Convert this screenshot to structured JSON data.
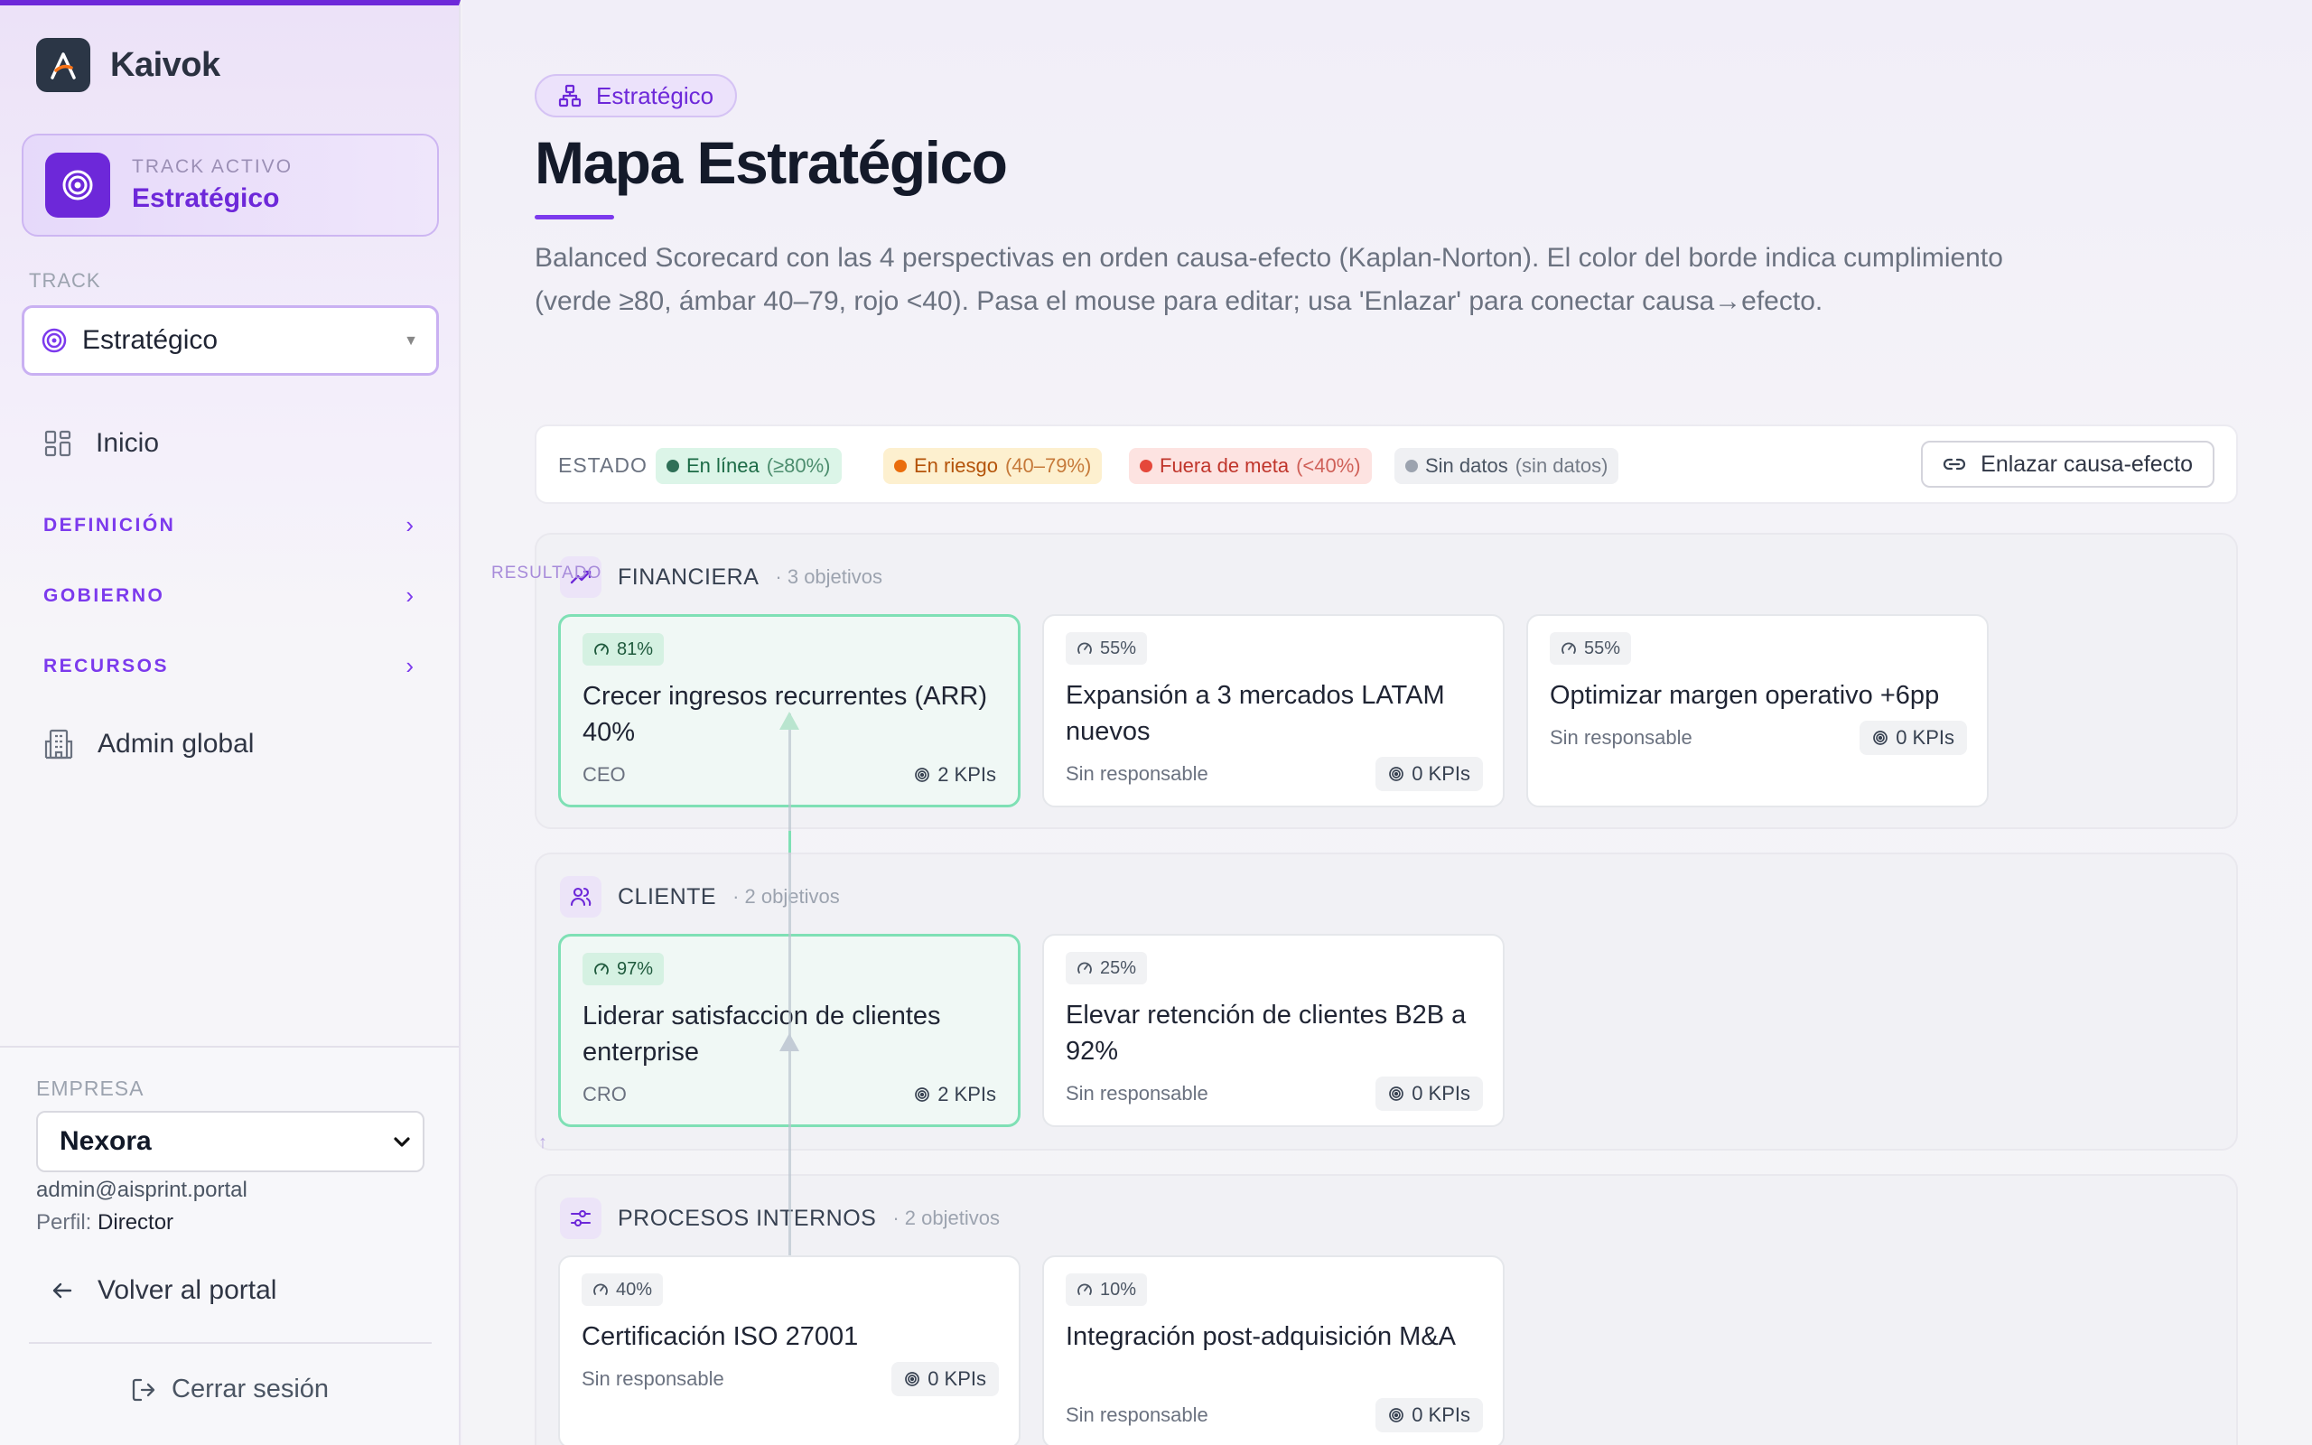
{
  "app": {
    "brand": "Kaivok",
    "colors": {
      "accent": "#6d28d9",
      "ok": "#22a06b",
      "warn": "#f59e0b",
      "bad": "#ef4444",
      "none": "#9ca3af"
    }
  },
  "sidebar": {
    "active_track": {
      "caption": "TRACK ACTIVO",
      "name": "Estratégico",
      "icon": "target-icon"
    },
    "track_label": "TRACK",
    "track_select": {
      "value": "Estratégico",
      "icon": "target-icon"
    },
    "nav": {
      "home": {
        "label": "Inicio",
        "icon": "grid-icon"
      },
      "sections": [
        {
          "label": "DEFINICIÓN"
        },
        {
          "label": "GOBIERNO"
        },
        {
          "label": "RECURSOS"
        }
      ],
      "admin": {
        "label": "Admin global",
        "icon": "building-icon"
      }
    },
    "company": {
      "label": "EMPRESA",
      "value": "Nexora",
      "email": "admin@aisprint.portal",
      "role_label": "Perfil:",
      "role_value": "Director"
    },
    "back_label": "Volver al portal",
    "logout_label": "Cerrar sesión"
  },
  "main": {
    "pill_label": "Estratégico",
    "title": "Mapa Estratégico",
    "description": "Balanced Scorecard con las 4 perspectivas en orden causa-efecto (Kaplan-Norton). El color del borde indica cumplimiento (verde ≥80, ámbar 40–79, rojo <40). Pasa el mouse para editar; usa 'Enlazar' para conectar causa→efecto.",
    "legend": {
      "caption": "ESTADO",
      "items": [
        {
          "label": "En línea",
          "sub": "(≥80%)",
          "color": "#22a06b",
          "bg": "#dcf5e8",
          "text": "#1c6b46"
        },
        {
          "label": "En riesgo",
          "sub": "(40–79%)",
          "color": "#ea6d0c",
          "bg": "#fdf0cf",
          "text": "#b45309"
        },
        {
          "label": "Fuera de meta",
          "sub": "(<40%)",
          "color": "#e5483b",
          "bg": "#fde3e1",
          "text": "#c0352b"
        },
        {
          "label": "Sin datos",
          "sub": "(sin datos)",
          "color": "#9ca3af",
          "bg": "#eff0f3",
          "text": "#4b5563"
        }
      ],
      "link_button": "Enlazar causa-efecto"
    },
    "result_tag": "RESULTADO",
    "perspectives": [
      {
        "name": "FINANCIERA",
        "count": "· 3 objetivos",
        "icon": "trending-up-icon",
        "objectives": [
          {
            "pct": "81%",
            "title": "Crecer ingresos recurrentes (ARR) 40%",
            "owner": "CEO",
            "kpis": "2 KPIs",
            "status": "ok"
          },
          {
            "pct": "55%",
            "title": "Expansión a 3 mercados LATAM nuevos",
            "owner": "Sin responsable",
            "kpis": "0 KPIs",
            "status": "none"
          },
          {
            "pct": "55%",
            "title": "Optimizar margen operativo +6pp",
            "owner": "Sin responsable",
            "kpis": "0 KPIs",
            "status": "none"
          }
        ]
      },
      {
        "name": "CLIENTE",
        "count": "· 2 objetivos",
        "icon": "users-icon",
        "objectives": [
          {
            "pct": "97%",
            "title": "Liderar satisfaccion de clientes enterprise",
            "owner": "CRO",
            "kpis": "2 KPIs",
            "status": "ok"
          },
          {
            "pct": "25%",
            "title": "Elevar retención de clientes B2B a 92%",
            "owner": "Sin responsable",
            "kpis": "0 KPIs",
            "status": "none"
          }
        ]
      },
      {
        "name": "PROCESOS INTERNOS",
        "count": "· 2 objetivos",
        "icon": "sliders-icon",
        "objectives": [
          {
            "pct": "40%",
            "title": "Certificación ISO 27001",
            "owner": "Sin responsable",
            "kpis": "0 KPIs",
            "status": "none"
          },
          {
            "pct": "10%",
            "title": "Integración post-adquisición M&A",
            "owner": "Sin responsable",
            "kpis": "0 KPIs",
            "status": "none"
          }
        ]
      }
    ]
  }
}
